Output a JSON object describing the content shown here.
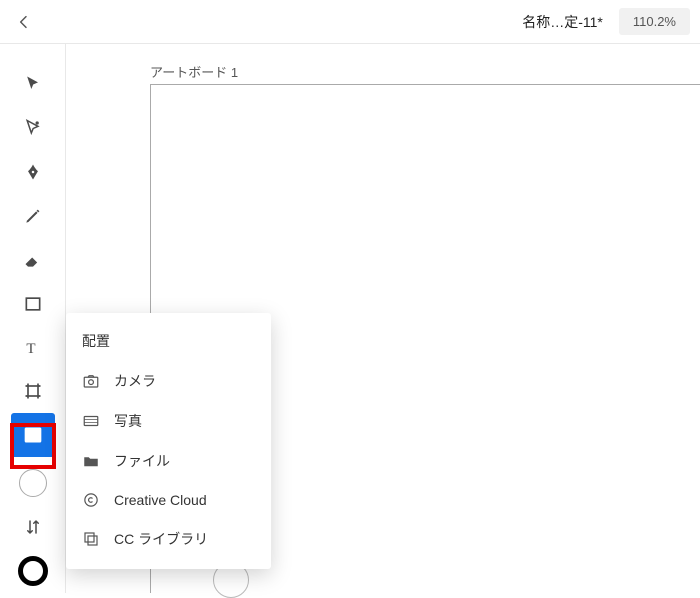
{
  "header": {
    "doc_title": "名称…定-11*",
    "zoom": "110.2%"
  },
  "canvas": {
    "artboard_label": "アートボード 1"
  },
  "toolbar": {
    "tools": [
      {
        "name": "selection-tool"
      },
      {
        "name": "direct-selection-tool"
      },
      {
        "name": "pen-tool"
      },
      {
        "name": "pencil-tool"
      },
      {
        "name": "eraser-tool"
      },
      {
        "name": "shape-tool"
      },
      {
        "name": "type-tool"
      },
      {
        "name": "artboard-tool"
      },
      {
        "name": "place-image-tool",
        "selected": true
      }
    ]
  },
  "popup": {
    "title": "配置",
    "items": [
      {
        "icon": "camera-icon",
        "label": "カメラ"
      },
      {
        "icon": "photos-icon",
        "label": "写真"
      },
      {
        "icon": "folder-icon",
        "label": "ファイル",
        "highlighted": true
      },
      {
        "icon": "cc-icon",
        "label": "Creative Cloud"
      },
      {
        "icon": "cc-libraries-icon",
        "label": "CC ライブラリ"
      }
    ]
  }
}
